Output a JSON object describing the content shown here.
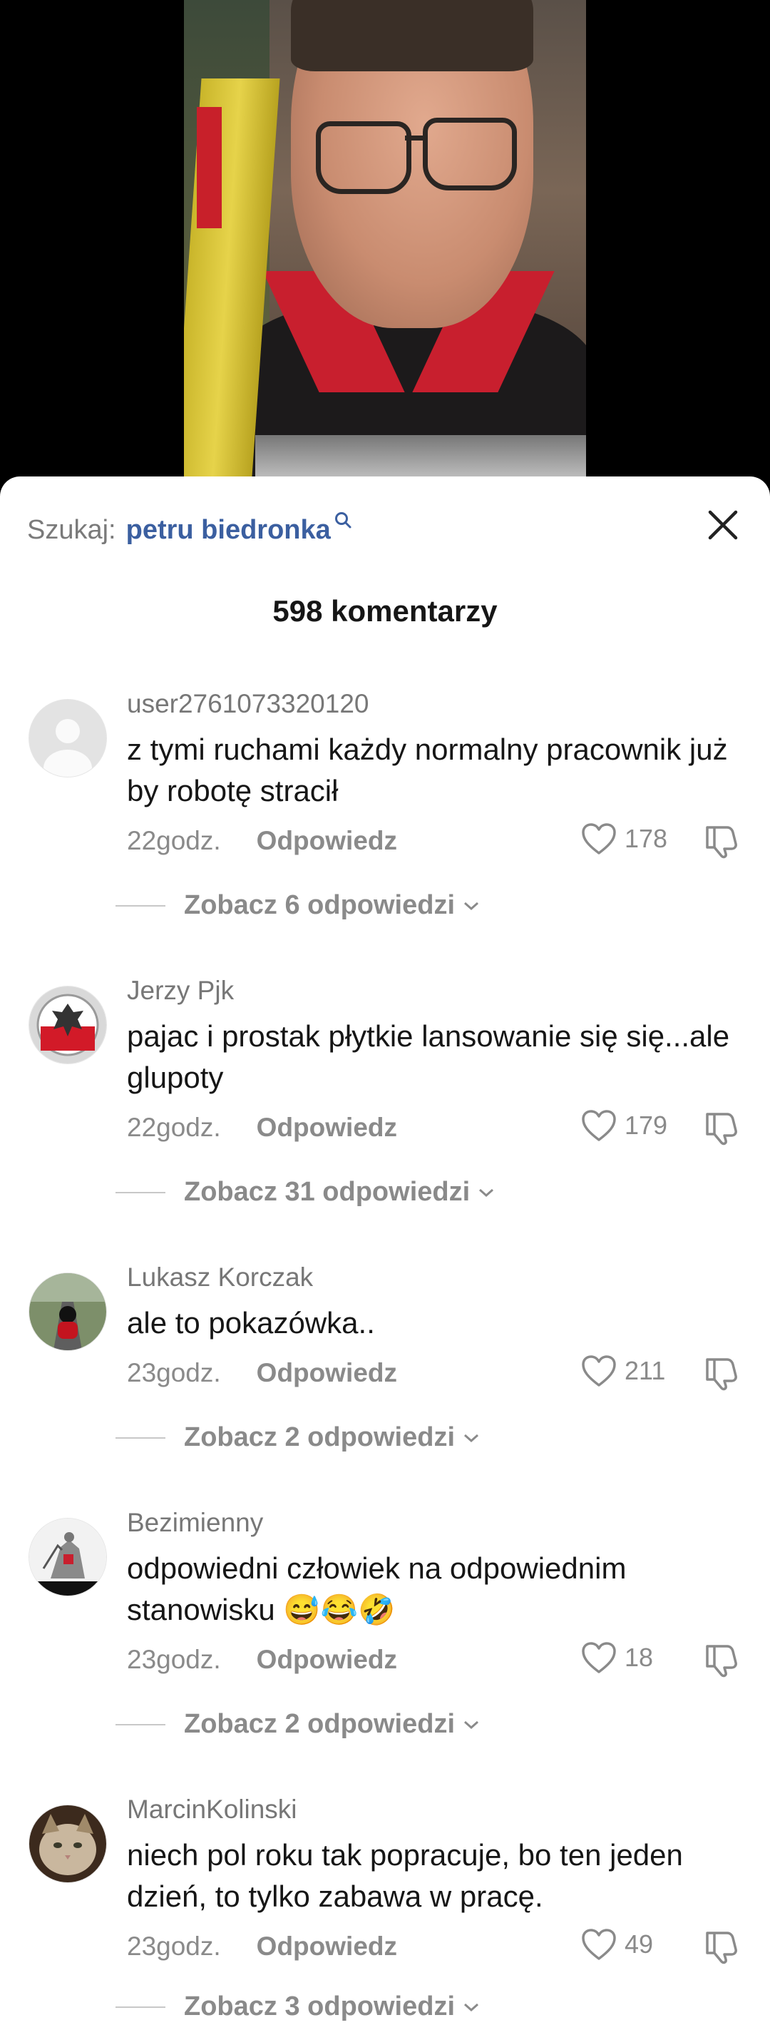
{
  "search": {
    "prefix": "Szukaj:",
    "term": "petru biedronka"
  },
  "comments_header": {
    "title": "598 komentarzy"
  },
  "comments": [
    {
      "username": "user2761073320120",
      "text": "z tymi ruchami każdy normalny pracownik już by robotę stracił",
      "time": "22godz.",
      "reply_label": "Odpowiedz",
      "likes": "178",
      "replies_label": "Zobacz 6 odpowiedzi"
    },
    {
      "username": "Jerzy Pjk",
      "text": "pajac i prostak płytkie lansowanie się się...ale glupoty",
      "time": "22godz.",
      "reply_label": "Odpowiedz",
      "likes": "179",
      "replies_label": "Zobacz 31 odpowiedzi"
    },
    {
      "username": "Lukasz Korczak",
      "text": "ale to pokazówka..",
      "time": "23godz.",
      "reply_label": "Odpowiedz",
      "likes": "211",
      "replies_label": "Zobacz 2 odpowiedzi"
    },
    {
      "username": "Bezimienny",
      "text": "odpowiedni człowiek na odpowiednim stanowisku 😅😂🤣",
      "time": "23godz.",
      "reply_label": "Odpowiedz",
      "likes": "18",
      "replies_label": "Zobacz 2 odpowiedzi"
    },
    {
      "username": "MarcinKolinski",
      "text": "niech pol roku tak popracuje, bo ten jeden dzień, to tylko zabawa w pracę.",
      "time": "23godz.",
      "reply_label": "Odpowiedz",
      "likes": "49",
      "replies_label": "Zobacz 3 odpowiedzi"
    }
  ],
  "colors": {
    "search_term": "#3b5fa0",
    "muted": "#8a8a8a",
    "text": "#161616"
  }
}
